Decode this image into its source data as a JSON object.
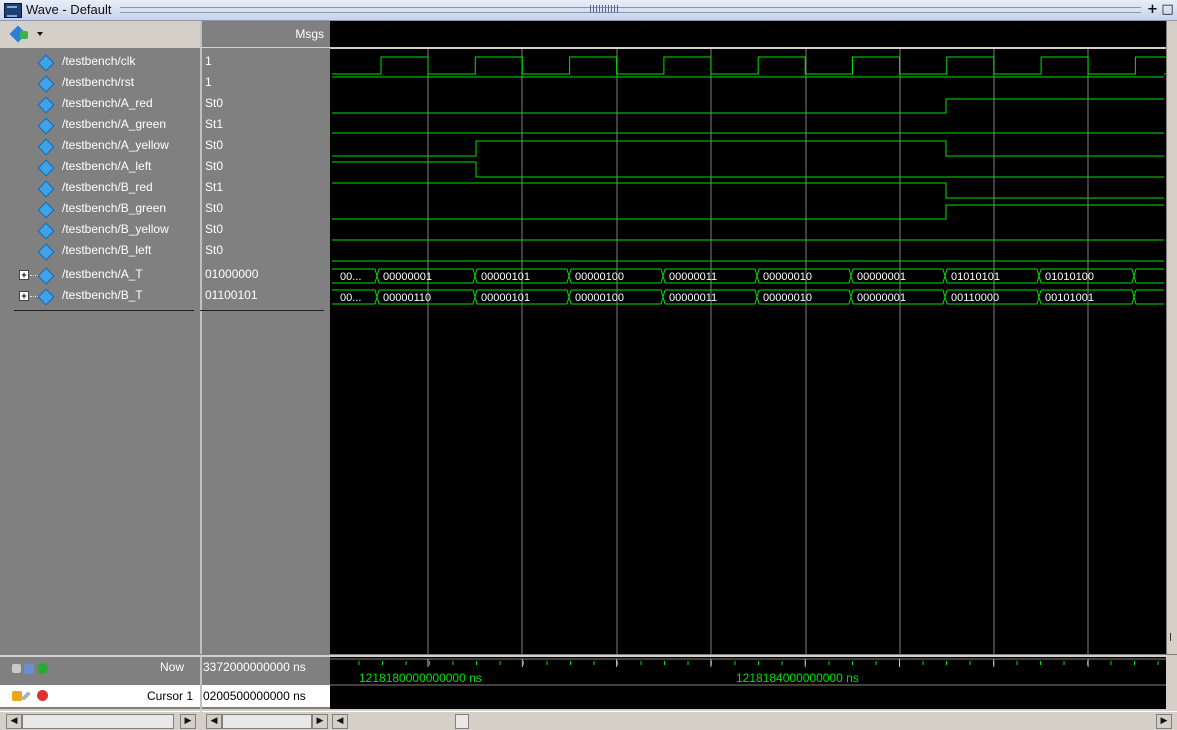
{
  "window": {
    "title": "Wave - Default"
  },
  "toolbar": {
    "msgs_header": "Msgs"
  },
  "signals": [
    {
      "name": "/testbench/clk",
      "value": "1",
      "kind": "bit"
    },
    {
      "name": "/testbench/rst",
      "value": "1",
      "kind": "bit"
    },
    {
      "name": "/testbench/A_red",
      "value": "St0",
      "kind": "bit"
    },
    {
      "name": "/testbench/A_green",
      "value": "St1",
      "kind": "bit"
    },
    {
      "name": "/testbench/A_yellow",
      "value": "St0",
      "kind": "bit"
    },
    {
      "name": "/testbench/A_left",
      "value": "St0",
      "kind": "bit"
    },
    {
      "name": "/testbench/B_red",
      "value": "St1",
      "kind": "bit"
    },
    {
      "name": "/testbench/B_green",
      "value": "St0",
      "kind": "bit"
    },
    {
      "name": "/testbench/B_yellow",
      "value": "St0",
      "kind": "bit"
    },
    {
      "name": "/testbench/B_left",
      "value": "St0",
      "kind": "bit"
    },
    {
      "name": "/testbench/A_T",
      "value": "01000000",
      "kind": "bus"
    },
    {
      "name": "/testbench/B_T",
      "value": "01100101",
      "kind": "bus"
    }
  ],
  "bus_values": {
    "A_T": [
      "00...",
      "00000001",
      "00000101",
      "00000100",
      "00000011",
      "00000010",
      "00000001",
      "01010101",
      "01010100"
    ],
    "B_T": [
      "00...",
      "00000110",
      "00000101",
      "00000100",
      "00000011",
      "00000010",
      "00000001",
      "00110000",
      "00101001"
    ]
  },
  "status": {
    "now_label": "Now",
    "now_value": "3372000000000 ns",
    "cursor_label": "Cursor 1",
    "cursor_value": "0200500000000 ns"
  },
  "timeline": {
    "label_1": "1218180000000000 ns",
    "label_2": "1218184000000000 ns"
  },
  "colors": {
    "wave": "#00e000",
    "background": "#000000",
    "panel": "#808080",
    "signal_icon": "#3fa3e8"
  },
  "icons": {
    "app": "wave-window-icon",
    "add_wave": "add-wave-icon",
    "now_tools": "now-toolbar-icons",
    "cursor_tools": "cursor-toolbar-icons"
  }
}
